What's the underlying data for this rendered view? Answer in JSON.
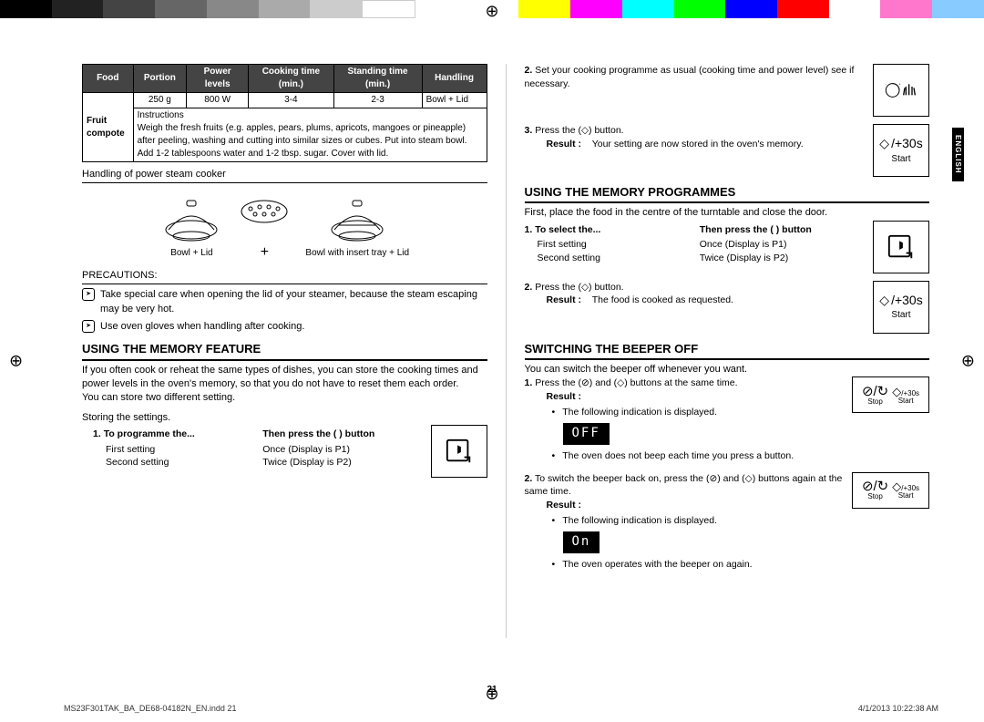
{
  "colorbar": [
    "#000",
    "#222",
    "#444",
    "#666",
    "#888",
    "#aaa",
    "#ccc",
    "#fff",
    "#ff0",
    "#f0f",
    "#0ff",
    "#0f0",
    "#00f",
    "#f00",
    "#fff",
    "#f7c",
    "#8cf"
  ],
  "language_tab": "ENGLISH",
  "page_number": "21",
  "footer": {
    "left": "MS23F301TAK_BA_DE68-04182N_EN.indd   21",
    "right": "4/1/2013   10:22:38 AM"
  },
  "left": {
    "table": {
      "headers": [
        "Food",
        "Portion",
        "Power levels",
        "Cooking time (min.)",
        "Standing time (min.)",
        "Handling"
      ],
      "row1_food": "Fruit compote",
      "row1": [
        "250 g",
        "800 W",
        "3-4",
        "2-3",
        "Bowl + Lid"
      ],
      "instructions_label": "Instructions",
      "instructions": "Weigh the fresh fruits (e.g. apples, pears, plums, apricots, mangoes or pineapple) after peeling, washing and cutting into similar sizes or cubes. Put into steam bowl. Add 1-2 tablespoons water and 1-2 tbsp. sugar. Cover with lid."
    },
    "handling_title": "Handling of power steam cooker",
    "steamer_cap1": "Bowl + Lid",
    "steamer_plus": "+",
    "steamer_cap2": "Bowl with insert tray + Lid",
    "precautions_title": "PRECAUTIONS:",
    "prec1": "Take special care when opening the lid of your steamer, because the steam escaping may be very hot.",
    "prec2": "Use oven gloves when handling after cooking.",
    "memfeat_title": "USING THE MEMORY FEATURE",
    "memfeat_body1": "If you often cook or reheat the same types of dishes, you can store the cooking times and power levels in the oven's memory, so that you do not have to reset them each order.",
    "memfeat_body2": "You can store two different setting.",
    "memfeat_body3": "Storing the settings.",
    "memprog_step1": "1.",
    "memprog_h1": "To programme the...",
    "memprog_h2": "Then press the (      ) button",
    "memprog_r1c1": "First setting",
    "memprog_r1c2": "Once (Display is P1)",
    "memprog_r2c1": "Second setting",
    "memprog_r2c2": "Twice (Display is P2)"
  },
  "right": {
    "step2_num": "2.",
    "step2": "Set your cooking programme as usual (cooking time and power level) see if necessary.",
    "step3_num": "3.",
    "step3_a": "Press the (",
    "step3_b": ") button.",
    "step3_result_label": "Result :",
    "step3_result": "Your setting are now stored in the oven's memory.",
    "memprog_title": "USING THE MEMORY PROGRAMMES",
    "memprog_intro": "First, place the food in the centre of the turntable and close the door.",
    "memprog_step1": "1.",
    "memprog_h1": "To select the...",
    "memprog_h2": "Then press the (      ) button",
    "memprog_r1c1": "First setting",
    "memprog_r1c2": "Once (Display is P1)",
    "memprog_r2c1": "Second setting",
    "memprog_r2c2": "Twice (Display is P2)",
    "memprog_step2_num": "2.",
    "memprog_step2_a": "Press the (",
    "memprog_step2_b": ") button.",
    "memprog_result_label": "Result :",
    "memprog_result": "The food is cooked as requested.",
    "beeper_title": "SWITCHING THE BEEPER OFF",
    "beeper_intro": "You can switch the beeper off whenever you want.",
    "beeper_s1_num": "1.",
    "beeper_s1_a": "Press the (",
    "beeper_s1_b": ") and (",
    "beeper_s1_c": ") buttons at the same time.",
    "beeper_s1_r_label": "Result :",
    "beeper_s1_b1": "The following indication is displayed.",
    "beeper_lcd1": "OFF",
    "beeper_s1_b2": "The oven does not beep each time you press a button.",
    "beeper_s2_num": "2.",
    "beeper_s2_a": "To switch the beeper back on, press the (",
    "beeper_s2_b": ") and (",
    "beeper_s2_c": ") buttons again at the same time.",
    "beeper_s2_r_label": "Result :",
    "beeper_s2_b1": "The following indication is displayed.",
    "beeper_lcd2": "On",
    "beeper_s2_b2": "The oven operates with the beeper on again.",
    "icon_start": "Start",
    "icon_30s": "/+30s",
    "icon_stop": "Stop"
  }
}
